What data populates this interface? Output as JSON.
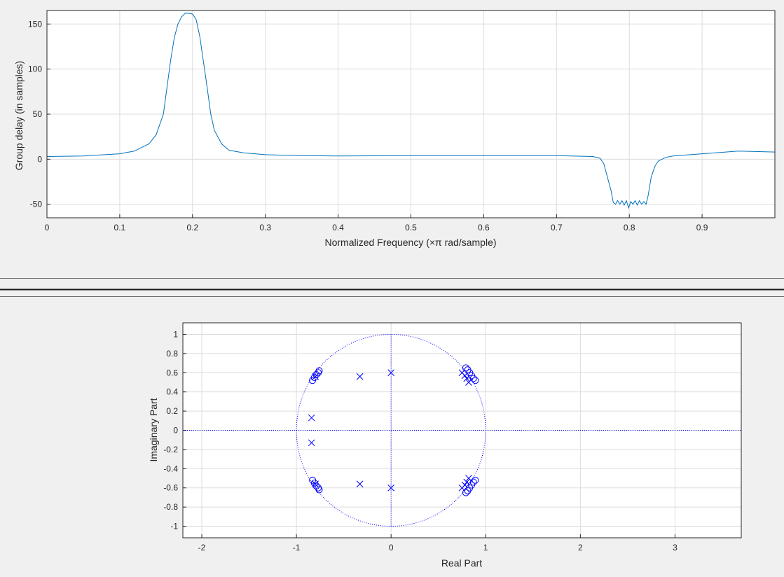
{
  "chart_data": [
    {
      "type": "line",
      "xlabel": "Normalized Frequency (×π rad/sample)",
      "ylabel": "Group delay (in samples)",
      "xlim": [
        0,
        1
      ],
      "ylim": [
        -65,
        165
      ],
      "xticks": [
        0,
        0.1,
        0.2,
        0.3,
        0.4,
        0.5,
        0.6,
        0.7,
        0.8,
        0.9
      ],
      "xtick_labels": [
        "0",
        "0.1",
        "0.2",
        "0.3",
        "0.4",
        "0.5",
        "0.6",
        "0.7",
        "0.8",
        "0.9"
      ],
      "yticks": [
        150,
        100,
        50,
        0,
        -50
      ],
      "ytick_labels": [
        "150",
        "100",
        "50",
        "0",
        "-50"
      ],
      "grid": true,
      "line_color": "#0072bd",
      "series": [
        {
          "x": [
            0,
            0.05,
            0.1,
            0.12,
            0.14,
            0.15,
            0.16,
            0.165,
            0.17,
            0.175,
            0.18,
            0.185,
            0.19,
            0.195,
            0.2,
            0.205,
            0.21,
            0.215,
            0.22,
            0.225,
            0.23,
            0.24,
            0.25,
            0.27,
            0.3,
            0.35,
            0.4,
            0.5,
            0.6,
            0.7,
            0.75,
            0.76,
            0.765,
            0.77,
            0.775,
            0.778,
            0.781,
            0.784,
            0.787,
            0.79,
            0.793,
            0.796,
            0.799,
            0.802,
            0.805,
            0.808,
            0.811,
            0.814,
            0.817,
            0.82,
            0.823,
            0.826,
            0.83,
            0.835,
            0.84,
            0.85,
            0.86,
            0.9,
            0.95,
            1.0
          ],
          "y": [
            3,
            3.5,
            6,
            9,
            17,
            27,
            50,
            80,
            110,
            135,
            150,
            158,
            162,
            162,
            161,
            155,
            136,
            108,
            80,
            50,
            32,
            17,
            10,
            7,
            5,
            4,
            3.5,
            4,
            4,
            4,
            3,
            1,
            -5,
            -20,
            -35,
            -48,
            -50,
            -46,
            -50,
            -46,
            -51,
            -46,
            -54,
            -47,
            -50,
            -46,
            -51,
            -46,
            -50,
            -47,
            -50,
            -40,
            -20,
            -8,
            -2,
            2,
            3.5,
            6,
            9,
            8
          ]
        }
      ]
    },
    {
      "type": "scatter",
      "xlabel": "Real Part",
      "ylabel": "Imaginary Part",
      "xlim": [
        -2.2,
        3.7
      ],
      "ylim": [
        -1.12,
        1.12
      ],
      "xticks": [
        -2,
        -1,
        0,
        1,
        2,
        3
      ],
      "xtick_labels": [
        "-2",
        "-1",
        "0",
        "1",
        "2",
        "3"
      ],
      "yticks": [
        1,
        0.8,
        0.6,
        0.4,
        0.2,
        0,
        -0.2,
        -0.4,
        -0.6,
        -0.8,
        -1
      ],
      "ytick_labels": [
        "1",
        "0.8",
        "0.6",
        "0.4",
        "0.2",
        "0",
        "-0.2",
        "-0.4",
        "-0.6",
        "-0.8",
        "-1"
      ],
      "grid": true,
      "marker_color": "#0000ff",
      "unit_circle": true,
      "zeros": [
        [
          -0.83,
          0.52
        ],
        [
          -0.81,
          0.55
        ],
        [
          -0.79,
          0.58
        ],
        [
          -0.77,
          0.6
        ],
        [
          -0.76,
          0.62
        ],
        [
          -0.83,
          -0.52
        ],
        [
          -0.81,
          -0.55
        ],
        [
          -0.79,
          -0.58
        ],
        [
          -0.77,
          -0.6
        ],
        [
          -0.76,
          -0.62
        ],
        [
          0.79,
          0.65
        ],
        [
          0.81,
          0.63
        ],
        [
          0.83,
          0.6
        ],
        [
          0.85,
          0.57
        ],
        [
          0.87,
          0.54
        ],
        [
          0.89,
          0.52
        ],
        [
          0.79,
          -0.65
        ],
        [
          0.81,
          -0.63
        ],
        [
          0.83,
          -0.6
        ],
        [
          0.85,
          -0.57
        ],
        [
          0.87,
          -0.54
        ],
        [
          0.89,
          -0.52
        ]
      ],
      "poles": [
        [
          -0.8,
          0.56
        ],
        [
          -0.33,
          0.56
        ],
        [
          0,
          0.6
        ],
        [
          -0.84,
          0.13
        ],
        [
          -0.84,
          -0.13
        ],
        [
          -0.8,
          -0.56
        ],
        [
          -0.33,
          -0.56
        ],
        [
          0,
          -0.6
        ],
        [
          0.75,
          0.6
        ],
        [
          0.78,
          0.57
        ],
        [
          0.8,
          0.54
        ],
        [
          0.82,
          0.5
        ],
        [
          0.75,
          -0.6
        ],
        [
          0.78,
          -0.57
        ],
        [
          0.8,
          -0.54
        ],
        [
          0.82,
          -0.5
        ]
      ]
    }
  ]
}
